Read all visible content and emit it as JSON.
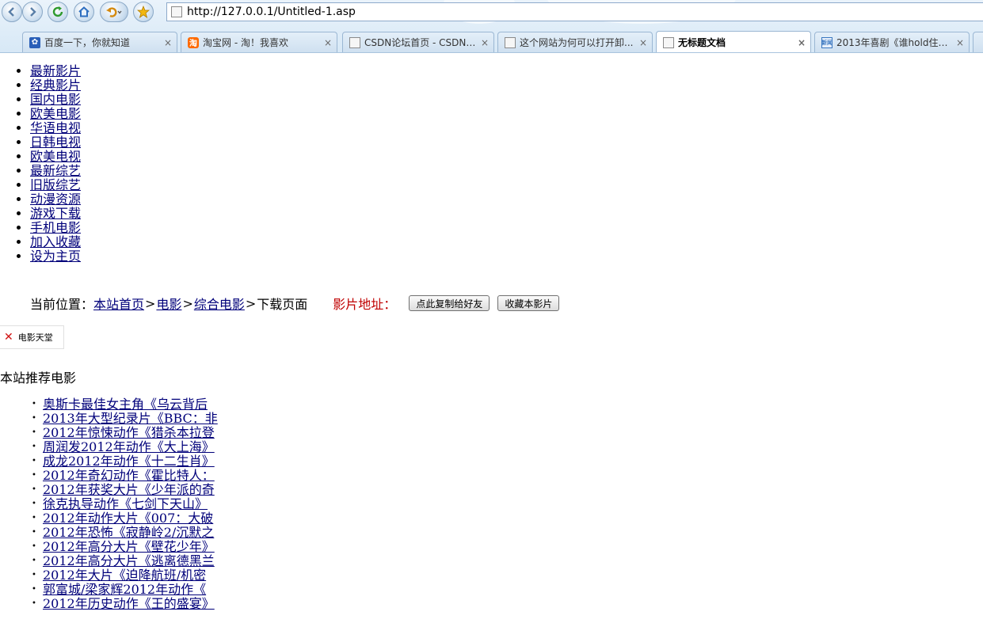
{
  "browser": {
    "url": "http://127.0.0.1/Untitled-1.asp",
    "tabs": [
      {
        "title": "百度一下，你就知道",
        "icon": "paw-icon",
        "active": false
      },
      {
        "title": "淘宝网 - 淘！我喜欢",
        "icon": "taobao-icon",
        "active": false
      },
      {
        "title": "CSDN论坛首页 - CSDN.NET",
        "icon": "page-icon",
        "active": false
      },
      {
        "title": "这个网站为何可以打开卸...",
        "icon": "page-icon",
        "active": false
      },
      {
        "title": "无标题文档",
        "icon": "page-icon",
        "active": true
      },
      {
        "title": "2013年喜剧《谁hold住谁...",
        "icon": "news-icon",
        "active": false
      }
    ],
    "close_glyph": "×",
    "taobao_glyph": "淘",
    "news_glyph": "新闻"
  },
  "nav": {
    "items": [
      "最新影片",
      "经典影片",
      "国内电影",
      "欧美电影",
      "华语电视",
      "日韩电视",
      "欧美电视",
      "最新综艺",
      "旧版综艺",
      "动漫资源",
      "游戏下载",
      "手机电影",
      "加入收藏",
      "设为主页"
    ]
  },
  "location": {
    "prefix": "当前位置：",
    "crumbs": [
      "本站首页",
      "电影",
      "综合电影"
    ],
    "separator": ">",
    "current": "下载页面",
    "address_label": "影片地址：",
    "copy_button": "点此复制给好友",
    "favorite_button": "收藏本影片"
  },
  "image": {
    "alt": "电影天堂"
  },
  "recommend": {
    "title": "本站推荐电影",
    "bullet": "•",
    "items": [
      "奥斯卡最佳女主角《乌云背后",
      "2013年大型纪录片《BBC：非",
      "2012年惊悚动作《猎杀本拉登",
      "周润发2012年动作《大上海》",
      "成龙2012年动作《十二生肖》",
      "2012年奇幻动作《霍比特人：",
      "2012年获奖大片《少年派的奇",
      "徐克执导动作《七剑下天山》",
      "2012年动作大片《007：大破",
      "2012年恐怖《寂静岭2/沉默之",
      "2012年高分大片《壁花少年》",
      "2012年高分大片《逃离德黑兰",
      "2012年大片《迫降航班/机密",
      "郭富城/梁家辉2012年动作《",
      "2012年历史动作《王的盛宴》"
    ]
  }
}
